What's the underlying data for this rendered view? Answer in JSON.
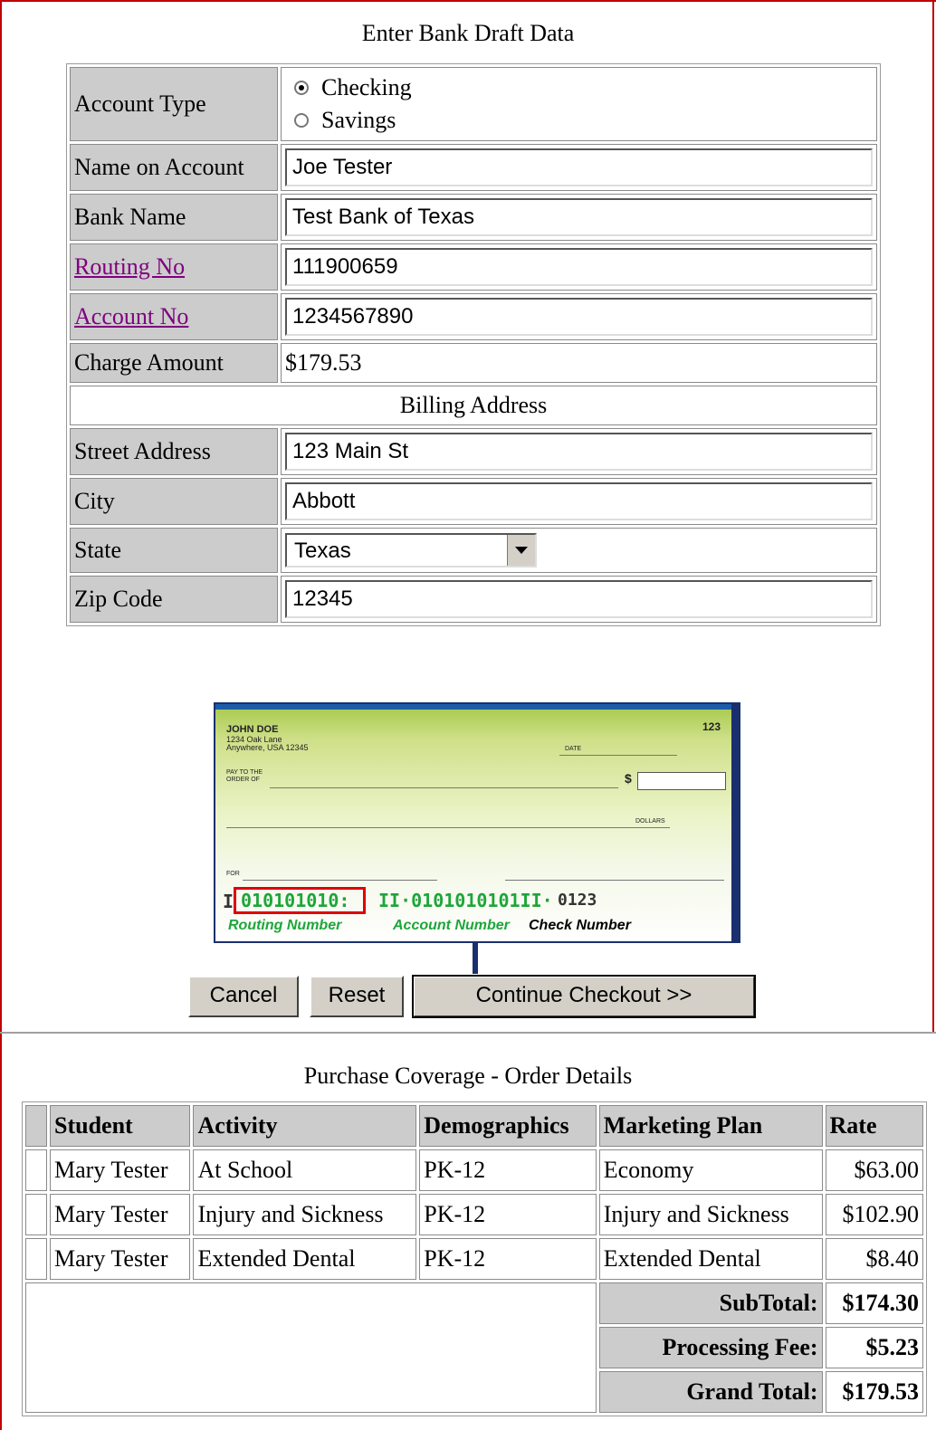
{
  "form": {
    "title": "Enter Bank Draft Data",
    "account_type_label": "Account Type",
    "account_type_options": [
      "Checking",
      "Savings"
    ],
    "account_type_selected": "Checking",
    "name_label": "Name on Account",
    "name_value": "Joe Tester",
    "bank_label": "Bank Name",
    "bank_value": "Test Bank of Texas",
    "routing_label": "Routing No",
    "routing_value": "111900659",
    "account_label": "Account No",
    "account_value": "1234567890",
    "charge_label": "Charge Amount",
    "charge_value": "$179.53",
    "billing_header": "Billing Address",
    "street_label": "Street Address",
    "street_value": "123 Main St",
    "city_label": "City",
    "city_value": "Abbott",
    "state_label": "State",
    "state_value": "Texas",
    "zip_label": "Zip Code",
    "zip_value": "12345"
  },
  "check_image": {
    "name": "JOHN DOE",
    "address1": "1234 Oak Lane",
    "address2": "Anywhere, USA 12345",
    "check_no": "123",
    "date_label": "DATE",
    "pay_label1": "PAY TO THE",
    "pay_label2": "ORDER OF",
    "dollar_sign": "$",
    "dollars_label": "DOLLARS",
    "for_label": "FOR",
    "micr_routing": "010101010:",
    "micr_account": "II·0101010101II·",
    "micr_check": "0123",
    "routing_caption": "Routing Number",
    "account_caption": "Account Number",
    "check_caption": "Check Number"
  },
  "buttons": {
    "cancel": "Cancel",
    "reset": "Reset",
    "continue": "Continue Checkout >>"
  },
  "order": {
    "title": "Purchase Coverage - Order Details",
    "columns": [
      "Student",
      "Activity",
      "Demographics",
      "Marketing Plan",
      "Rate"
    ],
    "rows": [
      [
        "Mary Tester",
        "At School",
        "PK-12",
        "Economy",
        "$63.00"
      ],
      [
        "Mary Tester",
        "Injury and Sickness",
        "PK-12",
        "Injury and Sickness",
        "$102.90"
      ],
      [
        "Mary Tester",
        "Extended Dental",
        "PK-12",
        "Extended Dental",
        "$8.40"
      ]
    ],
    "subtotal_label": "SubTotal:",
    "subtotal_value": "$174.30",
    "fee_label": "Processing Fee:",
    "fee_value": "$5.23",
    "grand_label": "Grand Total:",
    "grand_value": "$179.53"
  },
  "colors": {
    "frame": "#c00000",
    "label_bg": "#cccccc",
    "link": "#800080",
    "micr_green": "#1da63a",
    "check_border": "#1a2f6e"
  }
}
